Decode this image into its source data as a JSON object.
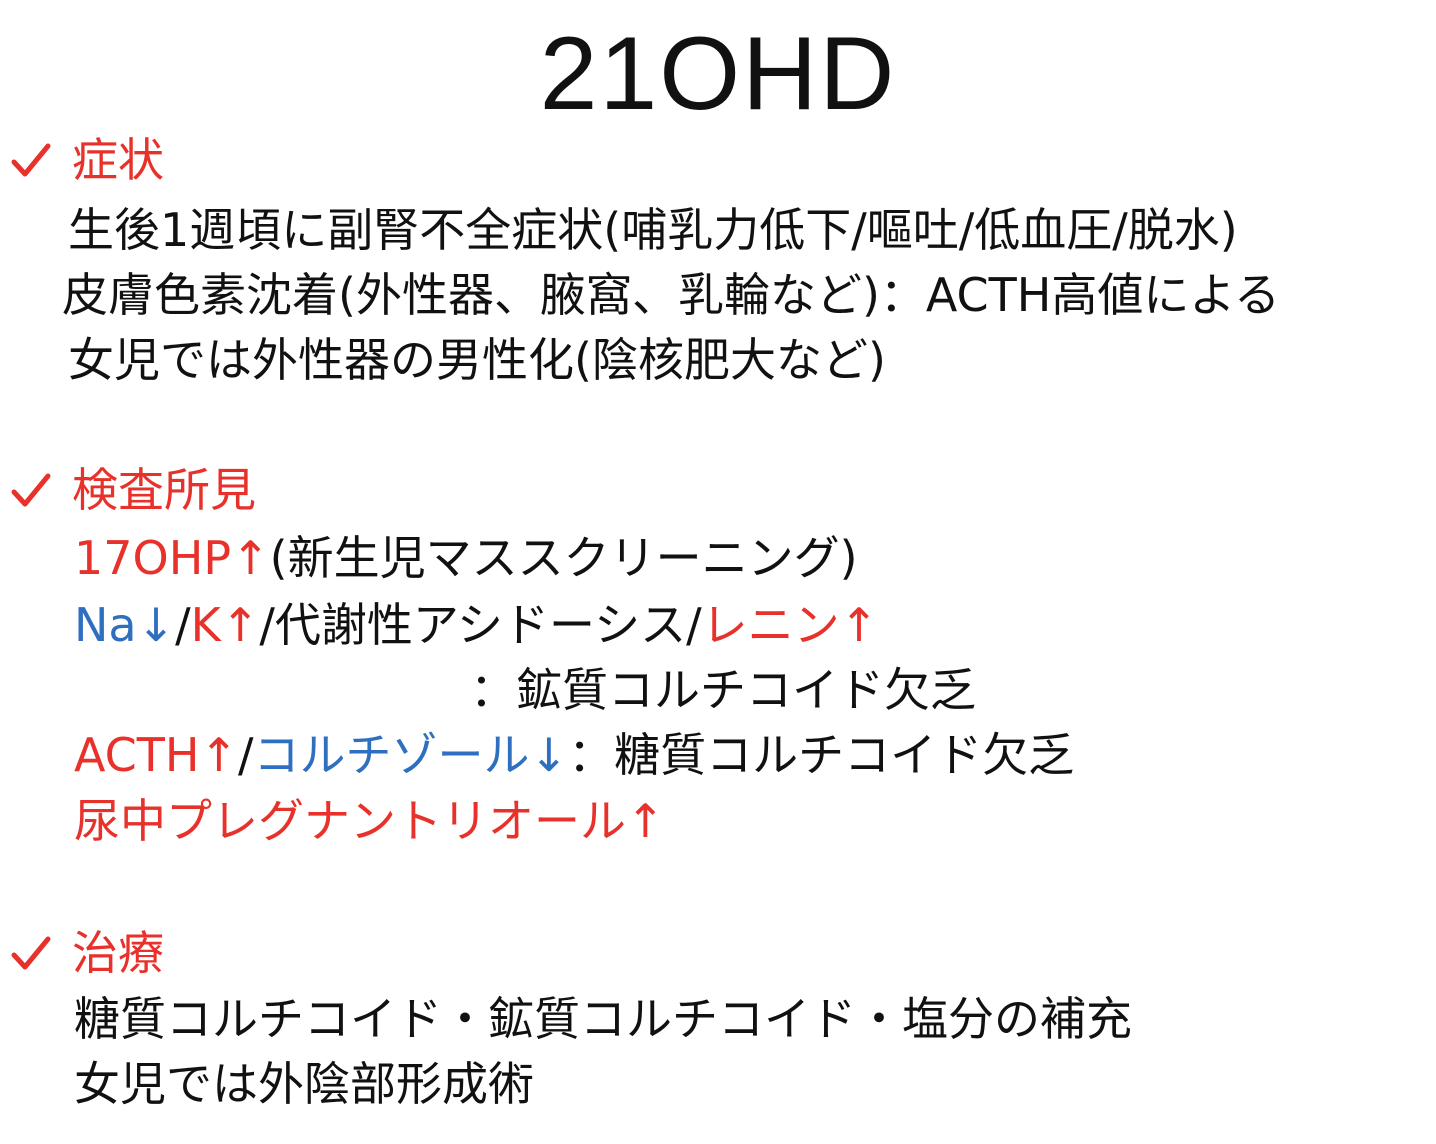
{
  "title": "21OHD",
  "colors": {
    "heading": "#e8312a",
    "increase": "#e8312a",
    "decrease": "#2e6fc0",
    "text": "#111111"
  },
  "sections": {
    "symptoms": {
      "heading": "症状",
      "line1": "生後1週頃に副腎不全症状(哺乳力低下/嘔吐/低血圧/脱水)",
      "line2": "皮膚色素沈着(外性器、腋窩、乳輪など)：ACTH高値による",
      "line3": "女児では外性器の男性化(陰核肥大など)"
    },
    "findings": {
      "heading": "検査所見",
      "line1_red": "17OHP↑",
      "line1_black": "(新生児マススクリーニング)",
      "line2_na": "Na↓",
      "line2_slash1": "/",
      "line2_k": "K↑",
      "line2_mid": "/代謝性アシドーシス/",
      "line2_renin": "レニン↑",
      "line3": "：鉱質コルチコイド欠乏",
      "line4_acth": "ACTH↑",
      "line4_slash": "/",
      "line4_cortisol": "コルチゾール↓",
      "line4_rest": "：糖質コルチコイド欠乏",
      "line5": "尿中プレグナントリオール↑"
    },
    "treatment": {
      "heading": "治療",
      "line1": "糖質コルチコイド・鉱質コルチコイド・塩分の補充",
      "line2": "女児では外陰部形成術"
    }
  },
  "icons": [
    "check-icon"
  ]
}
